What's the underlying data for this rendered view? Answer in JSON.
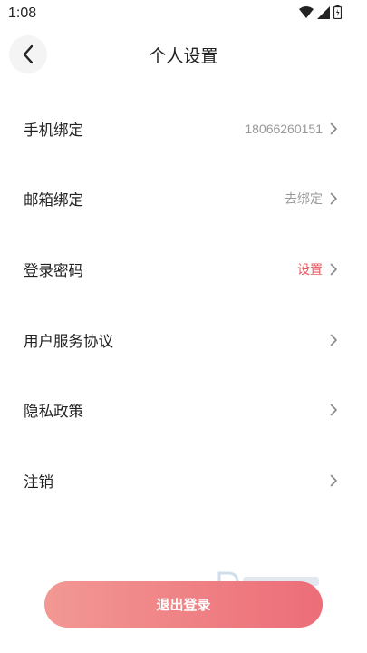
{
  "status_bar": {
    "time": "1:08",
    "icons": [
      "wifi-icon",
      "signal-icon",
      "battery-icon"
    ]
  },
  "header": {
    "title": "个人设置",
    "back_icon": "chevron-left-icon"
  },
  "settings": {
    "items": [
      {
        "label": "手机绑定",
        "value": "18066260151",
        "value_color": "#999999"
      },
      {
        "label": "邮箱绑定",
        "value": "去绑定",
        "value_color": "#999999"
      },
      {
        "label": "登录密码",
        "value": "设置",
        "value_color": "#e85a62"
      },
      {
        "label": "用户服务协议",
        "value": ""
      },
      {
        "label": "隐私政策",
        "value": ""
      },
      {
        "label": "注销",
        "value": ""
      }
    ],
    "chevron_icon": "chevron-right-icon"
  },
  "logout": {
    "label": "退出登录"
  },
  "colors": {
    "accent": "#e85a62",
    "button_gradient_start": "#f29893",
    "button_gradient_end": "#ec6d78"
  }
}
